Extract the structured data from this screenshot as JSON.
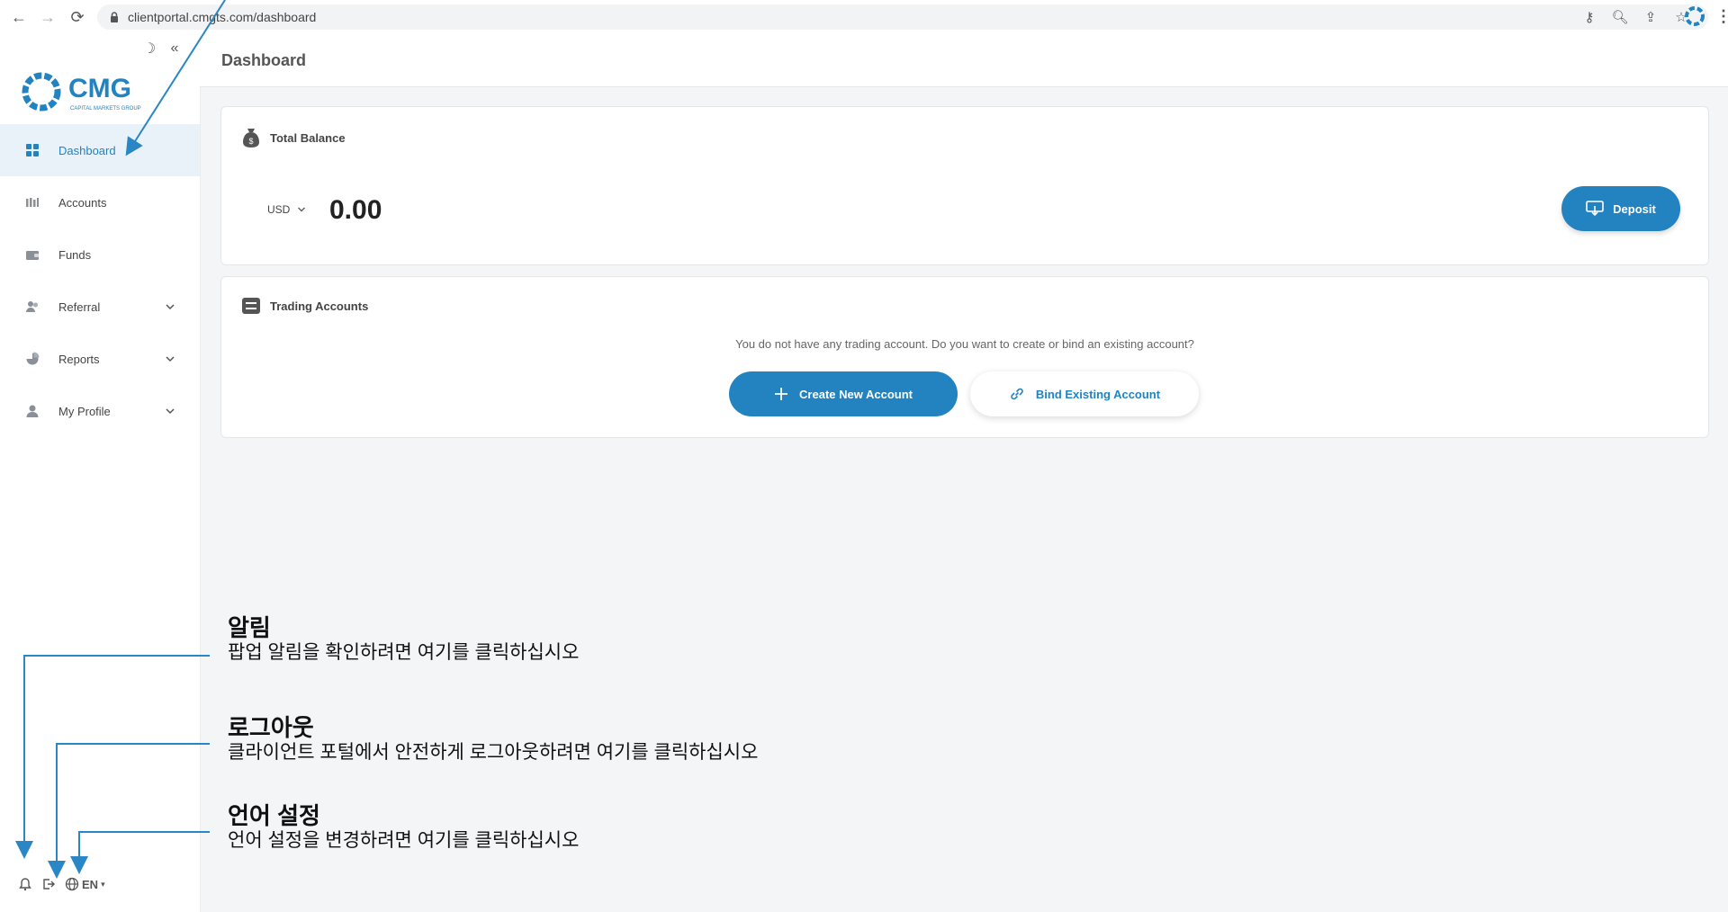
{
  "browser": {
    "url": "clientportal.cmgts.com/dashboard"
  },
  "sidebar": {
    "logo": {
      "name": "CMG",
      "tagline": "CAPITAL MARKETS GROUP"
    },
    "items": [
      {
        "label": "Dashboard",
        "active": true,
        "icon": "dashboard-icon"
      },
      {
        "label": "Accounts",
        "icon": "accounts-icon"
      },
      {
        "label": "Funds",
        "icon": "wallet-icon"
      },
      {
        "label": "Referral",
        "icon": "users-icon",
        "expandable": true
      },
      {
        "label": "Reports",
        "icon": "pie-chart-icon",
        "expandable": true
      },
      {
        "label": "My Profile",
        "icon": "user-icon",
        "expandable": true
      }
    ],
    "language": "EN"
  },
  "header": {
    "title": "Dashboard"
  },
  "balance": {
    "title": "Total Balance",
    "currency": "USD",
    "amount": "0.00",
    "deposit_label": "Deposit"
  },
  "trading": {
    "title": "Trading Accounts",
    "empty_message": "You do not have any trading account. Do you want to create or bind an existing account?",
    "create_label": "Create New Account",
    "bind_label": "Bind Existing Account"
  },
  "annotations": [
    {
      "title": "알림",
      "desc": "팝업 알림을 확인하려면 여기를 클릭하십시오"
    },
    {
      "title": "로그아웃",
      "desc": "클라이언트 포털에서 안전하게 로그아웃하려면 여기를 클릭하십시오"
    },
    {
      "title": "언어 설정",
      "desc": "언어 설정을 변경하려면 여기를 클릭하십시오"
    }
  ],
  "colors": {
    "accent": "#2283c0",
    "annotation_line": "#2a86c4"
  }
}
